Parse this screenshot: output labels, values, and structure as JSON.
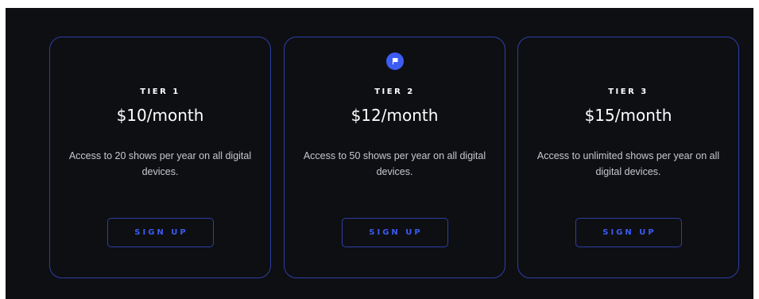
{
  "colors": {
    "background": "#0e0f13",
    "card_border": "#2f3fa6",
    "accent": "#3b5bf0",
    "badge": "#3d5cf2",
    "text": "#ffffff",
    "muted_text": "#c6c8cf"
  },
  "plans": [
    {
      "tier": "TIER 1",
      "price": "$10/month",
      "description": "Access to 20 shows per year on all digital devices.",
      "cta": "SIGN UP",
      "featured": false
    },
    {
      "tier": "TIER 2",
      "price": "$12/month",
      "description": "Access to 50 shows per year on all digital devices.",
      "cta": "SIGN UP",
      "featured": true,
      "badge_icon": "flag-icon"
    },
    {
      "tier": "TIER 3",
      "price": "$15/month",
      "description": "Access to unlimited shows per year on all digital devices.",
      "cta": "SIGN UP",
      "featured": false
    }
  ]
}
